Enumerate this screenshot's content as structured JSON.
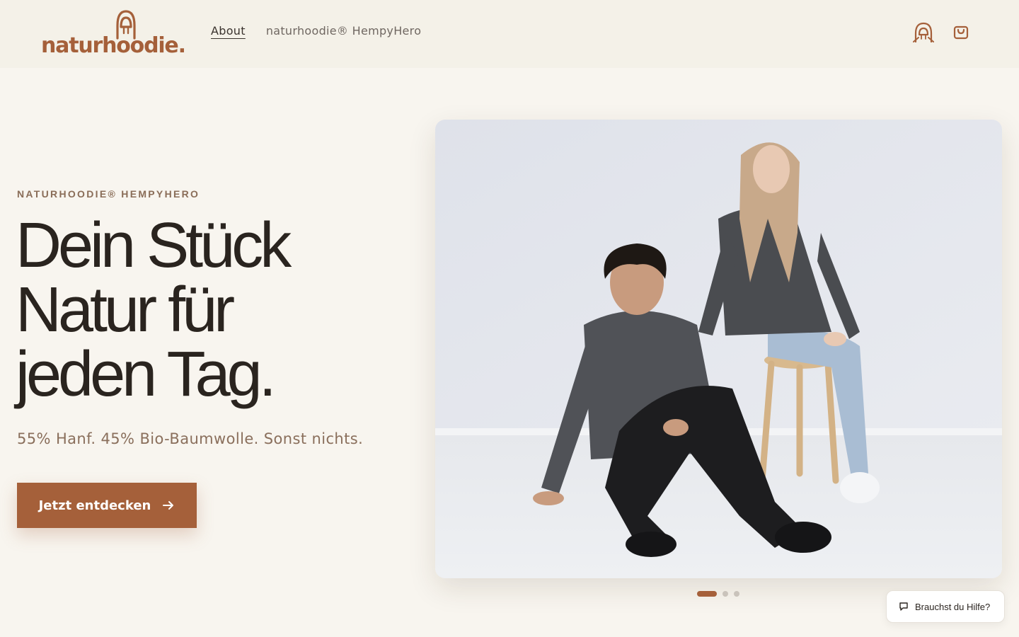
{
  "brand": {
    "logo_text": "naturhoodie.",
    "accent_color": "#a5603a"
  },
  "nav": {
    "items": [
      {
        "label": "About",
        "active": true
      },
      {
        "label": "naturhoodie® HempyHero",
        "active": false
      }
    ]
  },
  "header_icons": {
    "account": "account-icon",
    "cart": "cart-icon"
  },
  "hero": {
    "eyebrow": "NATURHOODIE® HEMPYHERO",
    "headline_lines": [
      "Dein Stück",
      "Natur für",
      "jeden Tag."
    ],
    "subline": "55% Hanf. 45% Bio-Baumwolle. Sonst nichts.",
    "cta_label": "Jetzt entdecken",
    "cta_icon": "arrow-right-icon"
  },
  "carousel": {
    "slide_count": 3,
    "active_index": 0
  },
  "help_widget": {
    "label": "Brauchst du Hilfe?",
    "icon": "chat-bubble-icon"
  }
}
